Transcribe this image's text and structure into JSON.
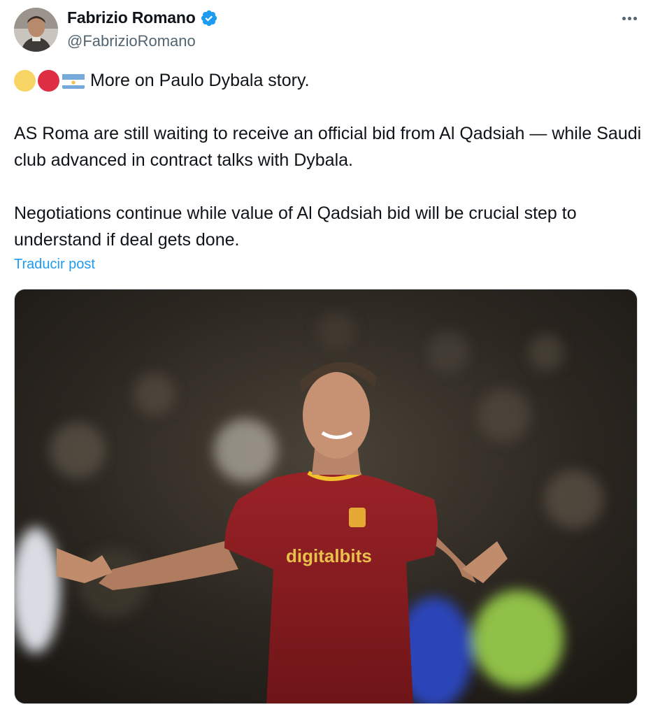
{
  "tweet": {
    "author": {
      "display_name": "Fabrizio Romano",
      "handle": "@FabrizioRomano",
      "verified_icon": "verified-badge-icon",
      "avatar_icon": "profile-avatar"
    },
    "more_icon": "more-options-icon",
    "line1": "More on Paulo Dybala story.",
    "line1_emojis": [
      "yellow-circle",
      "red-circle",
      "argentina-flag"
    ],
    "paragraph2": "AS Roma are still waiting to receive an official bid from Al Qadsiah — while Saudi club advanced in contract talks with Dybala.",
    "paragraph3": "Negotiations continue while value of Al Qadsiah bid will be crucial step to understand if deal gets done.",
    "translate_label": "Traducir post",
    "media": {
      "jersey_sponsor": "digitalbits"
    },
    "colors": {
      "link": "#1d9bf0",
      "secondary_text": "#536471",
      "verified": "#1d9bf0",
      "jersey": "#8b1c20"
    }
  }
}
